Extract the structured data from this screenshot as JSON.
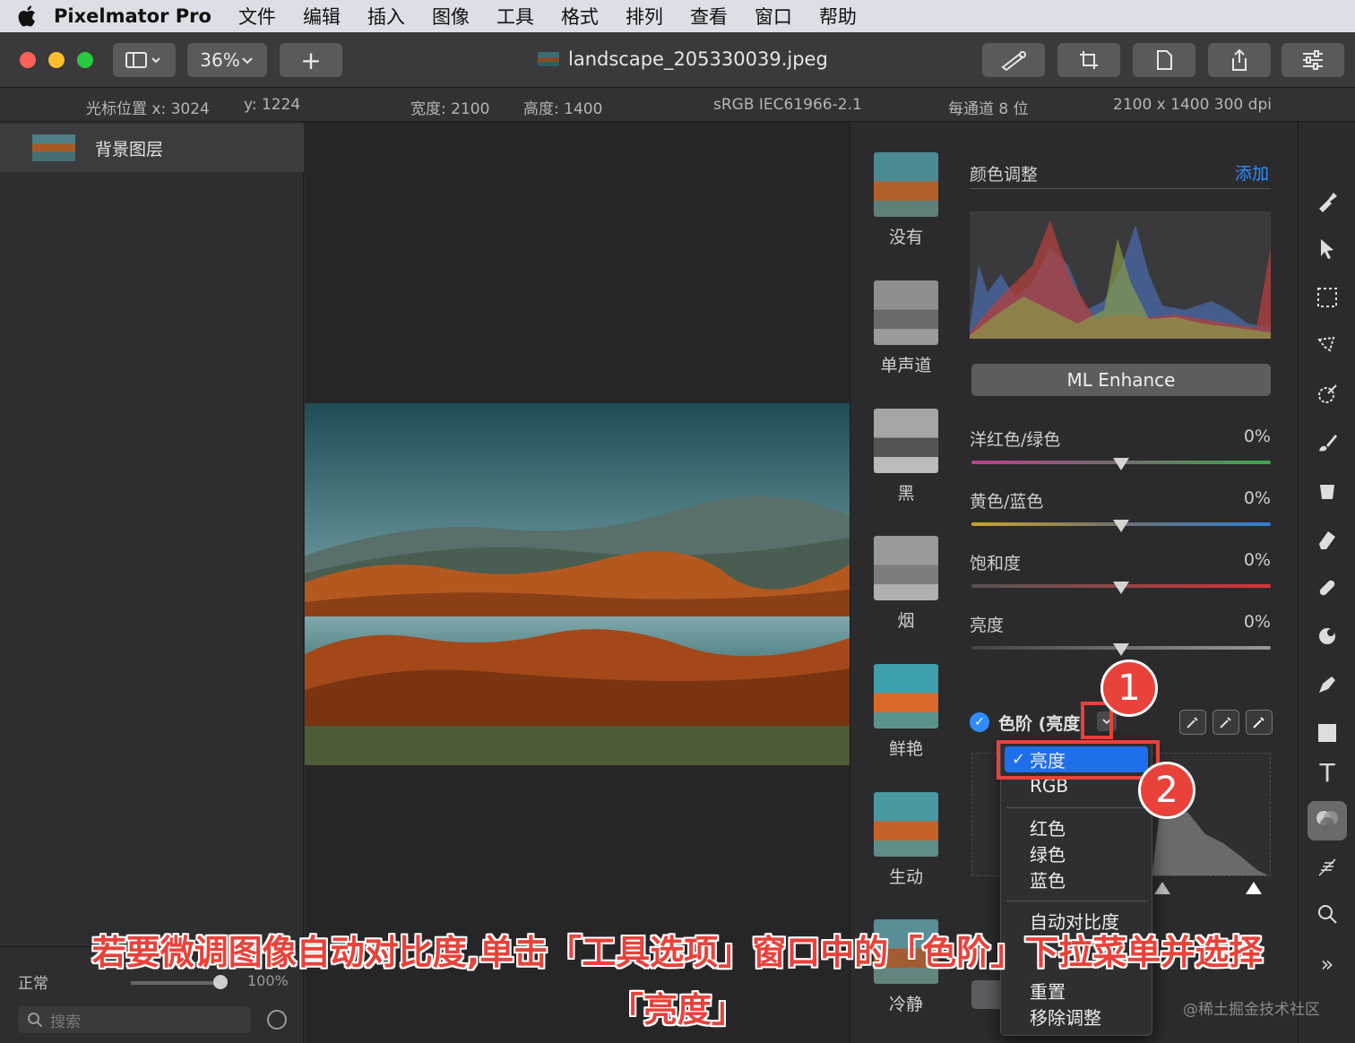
{
  "menubar": {
    "app_name": "Pixelmator Pro",
    "items": [
      "文件",
      "编辑",
      "插入",
      "图像",
      "工具",
      "格式",
      "排列",
      "查看",
      "窗口",
      "帮助"
    ]
  },
  "toolbar": {
    "zoom": "36%",
    "add": "+",
    "document_title": "landscape_205330039.jpeg"
  },
  "infobar": {
    "cursor_x": "光标位置 x:  3024",
    "cursor_y": "y:  1224",
    "width": "宽度:  2100",
    "height": "高度:  1400",
    "profile": "sRGB IEC61966-2.1",
    "bits": "每通道 8 位",
    "dimensions": "2100 x 1400 300 dpi"
  },
  "layers": {
    "items": [
      {
        "name": "背景图层"
      }
    ],
    "blend_mode": "正常",
    "opacity": "100%",
    "search_placeholder": "搜索"
  },
  "presets": [
    "没有",
    "单声道",
    "黑",
    "烟",
    "鲜艳",
    "生动",
    "冷静"
  ],
  "adjustments": {
    "section_title": "颜色调整",
    "add_label": "添加",
    "ml_enhance": "ML Enhance",
    "sliders": [
      {
        "label": "洋红色/绿色",
        "value": "0%"
      },
      {
        "label": "黄色/蓝色",
        "value": "0%"
      },
      {
        "label": "饱和度",
        "value": "0%"
      },
      {
        "label": "亮度",
        "value": "0%"
      }
    ],
    "levels_label": "色阶 (亮度"
  },
  "dropdown": {
    "selected": "亮度",
    "items": [
      "RGB",
      "红色",
      "绿色",
      "蓝色",
      "自动对比度",
      "重置",
      "移除调整"
    ]
  },
  "annotations": {
    "step1": "1",
    "step2": "2",
    "caption_line1": "若要微调图像自动对比度,单击「工具选项」窗口中的「色阶」下拉菜单并选择",
    "caption_line2": "「亮度」"
  },
  "watermark": "@稀土掘金技术社区"
}
